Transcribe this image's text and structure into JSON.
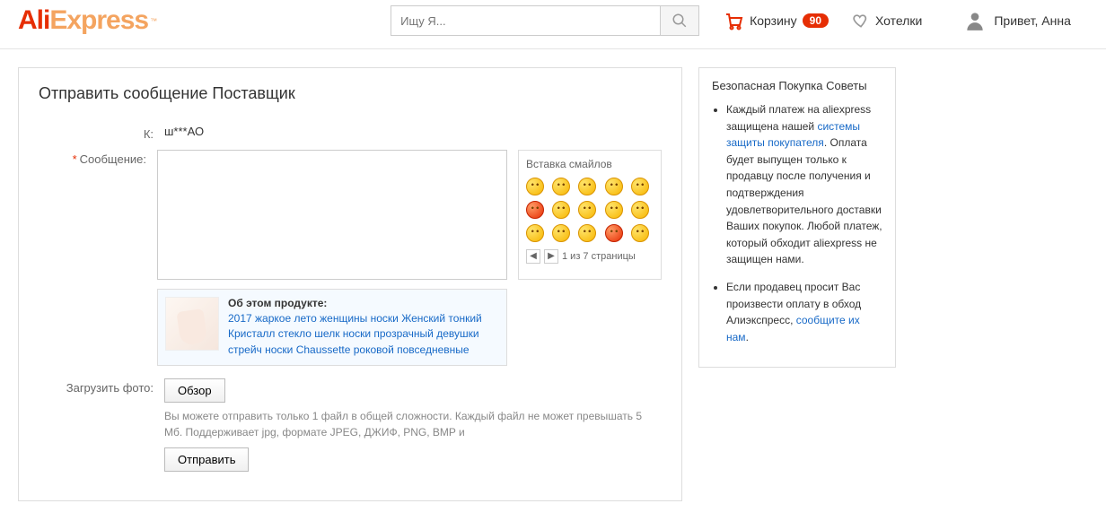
{
  "header": {
    "logo_part1": "Ali",
    "logo_part2": "Express",
    "logo_tm": "™",
    "search_placeholder": "Ищу Я...",
    "cart_label": "Корзину",
    "cart_count": "90",
    "wishlist_label": "Хотелки",
    "greeting": "Привет, Анна"
  },
  "page": {
    "title": "Отправить сообщение Поставщик",
    "labels": {
      "to": "К:",
      "message": "Сообщение:",
      "upload": "Загрузить фото:"
    },
    "recipient": "ш***АО",
    "smiley": {
      "title": "Вставка смайлов",
      "pager": "1 из 7 страницы"
    },
    "product": {
      "heading": "Об этом продукте:",
      "title": "2017 жаркое лето женщины носки Женский тонкий Кристалл стекло шелк носки прозрачный девушки стрейч носки Chaussette роковой повседневные"
    },
    "upload": {
      "button": "Обзор",
      "note": "Вы можете отправить только 1 файл в общей сложности. Каждый файл не может превышать 5 Мб. Поддерживает jpg, формате JPEG, ДЖИФ, PNG, BMP и"
    },
    "submit": "Отправить"
  },
  "side": {
    "title": "Безопасная Покупка Советы",
    "tips": [
      {
        "pre": "Каждый платеж на aliexpress защищена нашей ",
        "link": "системы защиты покупателя",
        "post": ". Оплата будет выпущен только к продавцу после получения и подтверждения удовлетворительного доставки Ваших покупок. Любой платеж, который обходит aliexpress не защищен нами."
      },
      {
        "pre": "Если продавец просит Вас произвести оплату в обход Алиэкспресс, ",
        "link": "сообщите их нам",
        "post": "."
      }
    ]
  }
}
